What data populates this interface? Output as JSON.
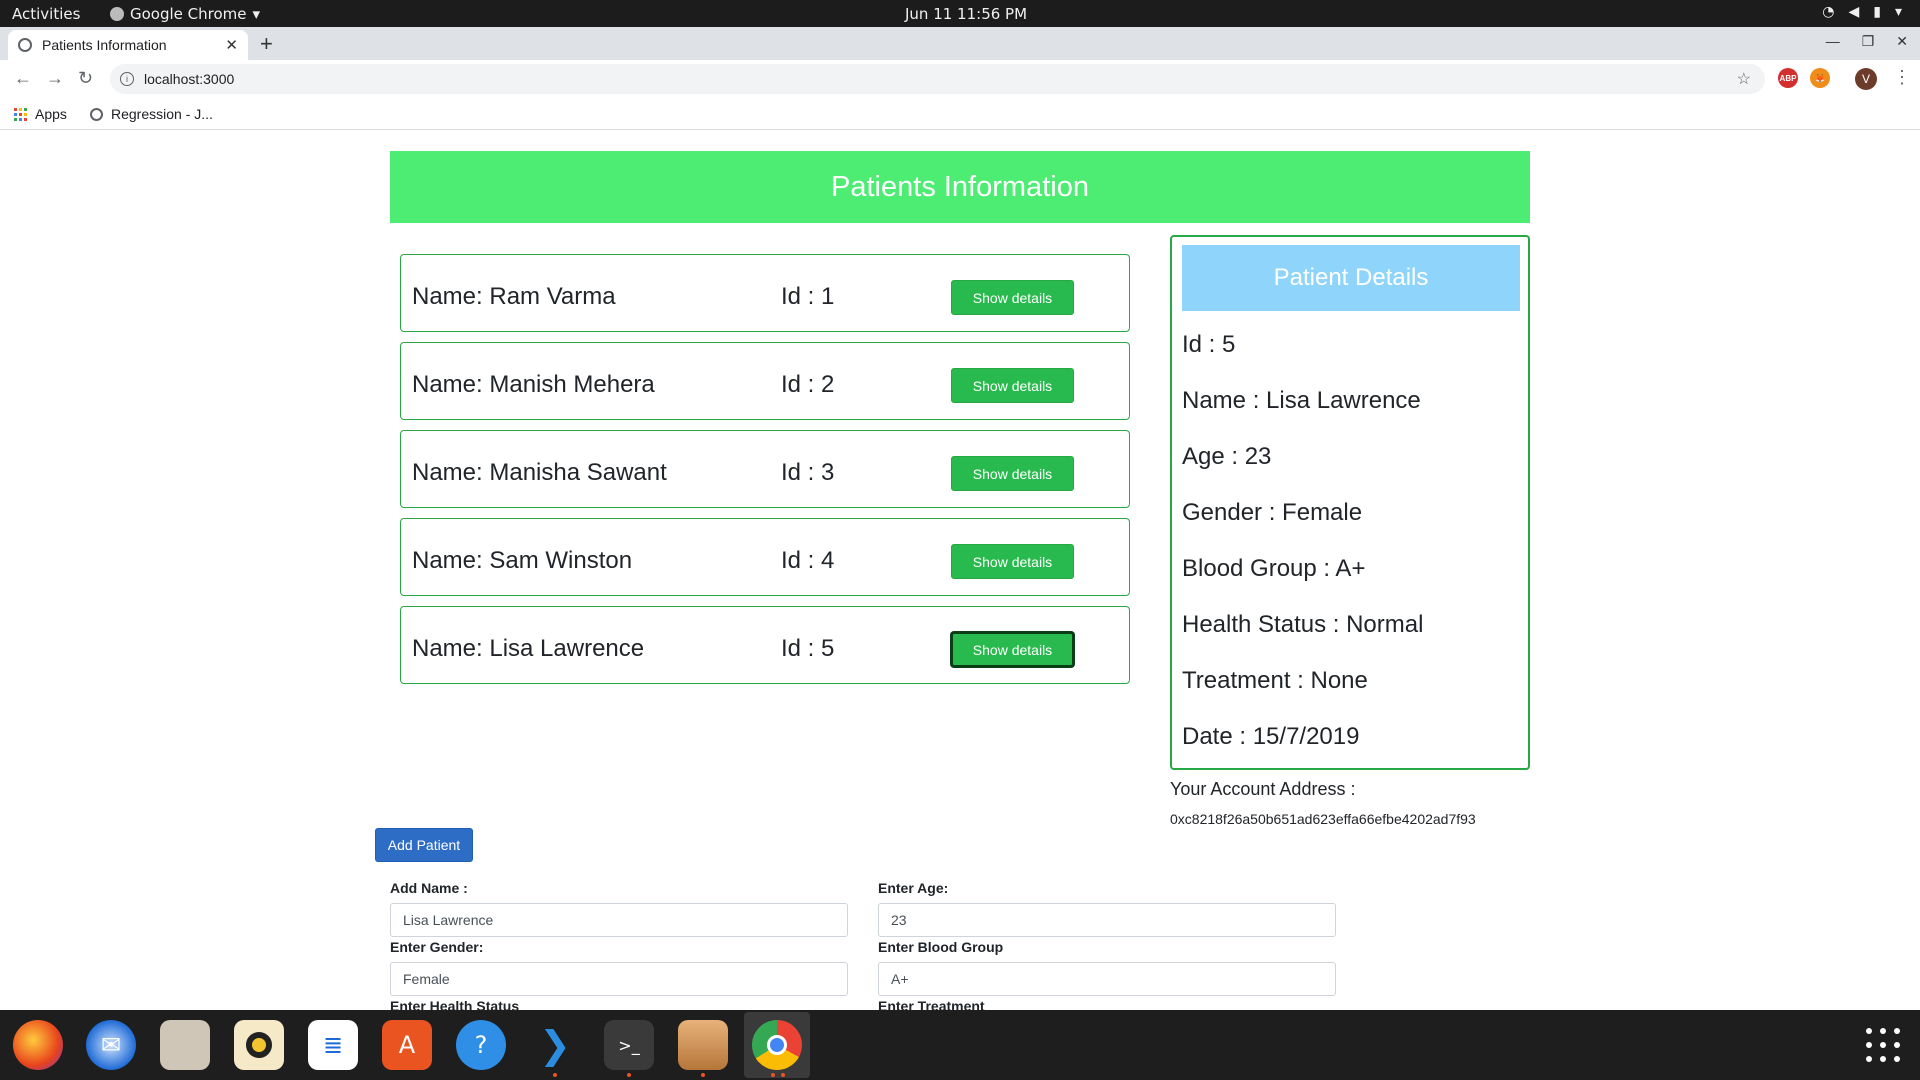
{
  "system": {
    "activities": "Activities",
    "app_name": "Google Chrome",
    "clock": "Jun 11  11:56 PM"
  },
  "browser": {
    "tab_title": "Patients Information",
    "url": "localhost:3000",
    "bookmarks": [
      "Apps",
      "Regression - J..."
    ],
    "profile_initial": "V",
    "extension_abp": "ABP"
  },
  "page": {
    "header": "Patients Information",
    "show_details_label": "Show details",
    "patients": [
      {
        "name": "Name: Ram Varma",
        "id": "Id : 1"
      },
      {
        "name": "Name: Manish Mehera",
        "id": "Id : 2"
      },
      {
        "name": "Name: Manisha Sawant",
        "id": "Id : 3"
      },
      {
        "name": "Name: Sam Winston",
        "id": "Id : 4"
      },
      {
        "name": "Name: Lisa Lawrence",
        "id": "Id : 5"
      }
    ],
    "details": {
      "title": "Patient Details",
      "lines": [
        "Id : 5",
        "Name : Lisa Lawrence",
        "Age : 23",
        "Gender : Female",
        "Blood Group : A+",
        "Health Status : Normal",
        "Treatment : None",
        "Date : 15/7/2019"
      ]
    },
    "account_label": "Your Account Address :",
    "account_address": "0xc8218f26a50b651ad623effa66efbe4202ad7f93",
    "add_patient_label": "Add Patient",
    "form": {
      "name_label": "Add Name :",
      "name_value": "Lisa Lawrence",
      "age_label": "Enter Age:",
      "age_value": "23",
      "gender_label": "Enter Gender:",
      "gender_value": "Female",
      "blood_label": "Enter Blood Group",
      "blood_value": "A+",
      "health_label": "Enter Health Status",
      "treatment_label": "Enter Treatment"
    }
  },
  "dock": [
    "firefox-icon",
    "thunderbird-icon",
    "files-icon",
    "rhythmbox-icon",
    "writer-icon",
    "software-icon",
    "help-icon",
    "vscode-icon",
    "terminal-icon",
    "package-icon",
    "chrome-icon"
  ],
  "colors": {
    "header_green": "#4ded73",
    "button_green": "#28ba4e",
    "card_border": "#28a745",
    "details_header": "#8fd5fb",
    "add_button": "#2d6dc6"
  }
}
